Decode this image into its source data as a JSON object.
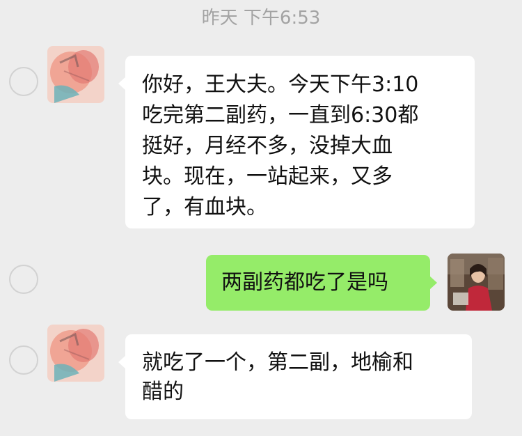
{
  "header": {
    "timestamp": "昨天 下午6:53"
  },
  "messages": [
    {
      "sender": "patient",
      "side": "left",
      "lines": [
        "你好，王大夫。今天下午3:10",
        "吃完第二副药，一直到6:30都",
        "挺好，月经不多，没掉大血",
        "块。现在，一站起来，又多",
        "了，有血块。"
      ]
    },
    {
      "sender": "doctor",
      "side": "right",
      "lines": [
        "两副药都吃了是吗"
      ]
    },
    {
      "sender": "patient",
      "side": "left",
      "lines": [
        "就吃了一个，第二副，地榆和",
        "醋的"
      ]
    }
  ],
  "colors": {
    "background": "#ededed",
    "incoming_bubble": "#ffffff",
    "outgoing_bubble": "#95ec69",
    "timestamp_text": "#a3a3a3",
    "message_text": "#111111"
  },
  "icons": {
    "select": "select-circle-icon"
  }
}
